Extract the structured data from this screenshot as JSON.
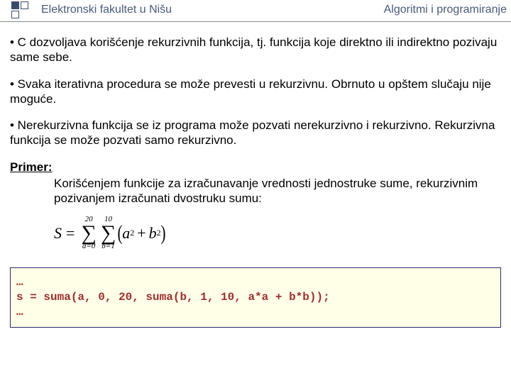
{
  "header": {
    "left": "Elektronski fakultet u Nišu",
    "right": "Algoritmi i programiranje"
  },
  "bullets": [
    "• C dozvoljava korišćenje rekurzivnih funkcija, tj. funkcija koje direktno ili indirektno pozivaju same sebe.",
    "• Svaka iterativna procedura se može prevesti u rekurzivnu. Obrnuto u opštem slučaju nije moguće.",
    "• Nerekurzivna funkcija se iz programa može pozvati nerekurzivno i rekurzivno. Rekurzivna funkcija se može pozvati samo rekurzivno."
  ],
  "primer": {
    "label": "Primer:",
    "text": "Korišćenjem funkcije za izračunavanje vrednosti jednostruke sume, rekurzivnim pozivanjem izračunati dvostruku sumu:"
  },
  "formula": {
    "lhs": "S",
    "eq": "=",
    "sum1_top": "20",
    "sum1_bot": "a=0",
    "sum2_top": "10",
    "sum2_bot": "b=1",
    "term_a": "a",
    "term_b": "b",
    "exp": "2",
    "plus": "+"
  },
  "code": {
    "line1": "…",
    "line2": "s = suma(a, 0, 20, suma(b, 1, 10, a*a + b*b));",
    "line3": "…"
  }
}
